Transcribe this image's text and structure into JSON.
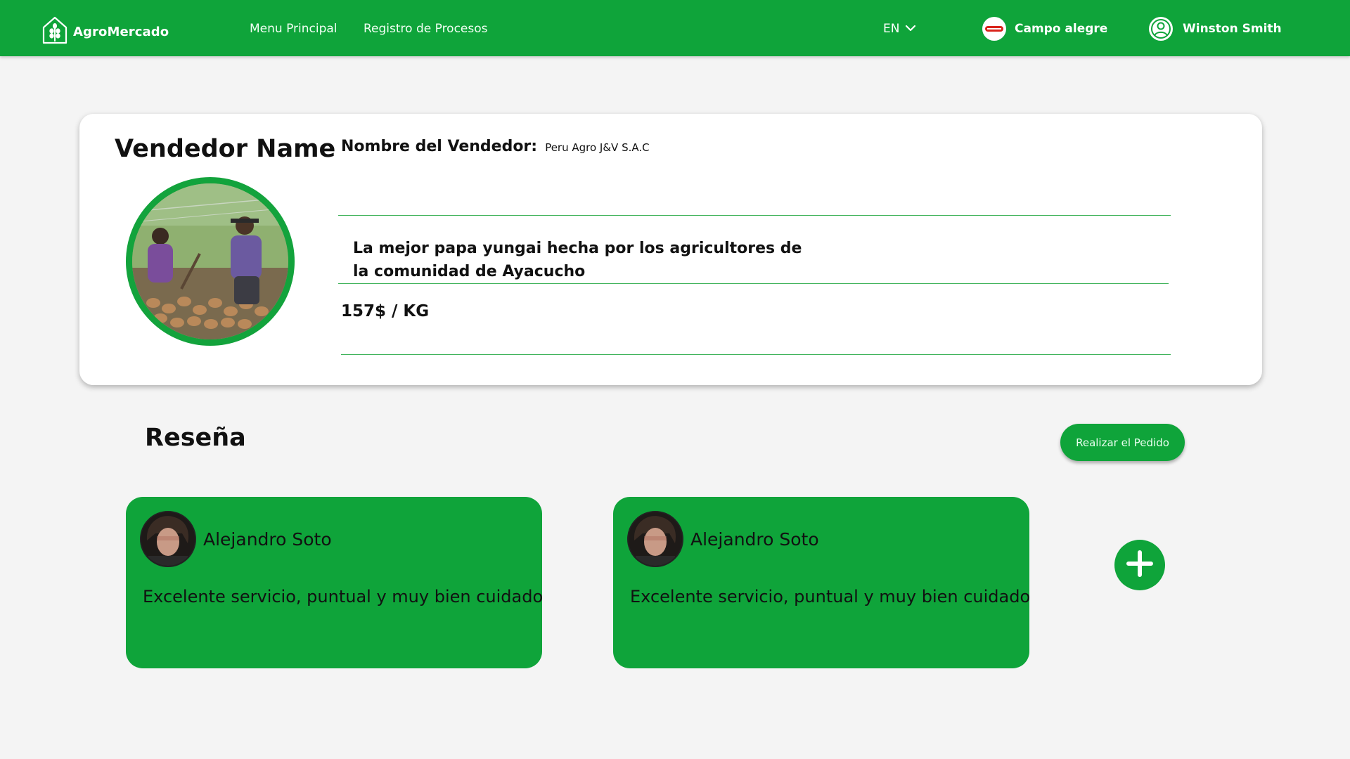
{
  "header": {
    "brand": "AgroMercado",
    "nav": [
      "Menu Principal",
      "Registro de Procesos"
    ],
    "language": "EN",
    "farm_name": "Campo alegre",
    "user_name": "Winston Smith"
  },
  "vendor": {
    "title": "Vendedor Name",
    "name_label": "Nombre del Vendedor:",
    "name_value": "Peru Agro J&V S.A.C",
    "description": "La mejor papa yungai hecha por los agricultores de la comunidad de Ayacucho",
    "price": "157$ / KG"
  },
  "reviews": {
    "title": "Reseña",
    "order_button": "Realizar el Pedido",
    "items": [
      {
        "author": "Alejandro Soto",
        "text": "Excelente servicio, puntual y muy bien cuidado"
      },
      {
        "author": "Alejandro Soto",
        "text": "Excelente servicio, puntual y muy bien cuidado"
      }
    ]
  },
  "colors": {
    "primary": "#0fa43a",
    "background": "#f4f4f4",
    "card": "#ffffff"
  },
  "icons": [
    "logo-leaf-house-icon",
    "chevron-down-icon",
    "farm-logo-icon",
    "user-circle-icon",
    "plus-icon"
  ]
}
